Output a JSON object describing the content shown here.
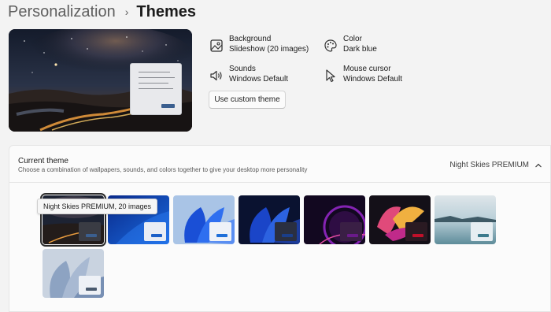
{
  "breadcrumb": {
    "parent": "Personalization",
    "separator": "›",
    "current": "Themes"
  },
  "properties": {
    "background": {
      "label": "Background",
      "value": "Slideshow (20 images)",
      "icon": "image-icon"
    },
    "color": {
      "label": "Color",
      "value": "Dark blue",
      "icon": "palette-icon"
    },
    "sounds": {
      "label": "Sounds",
      "value": "Windows Default",
      "icon": "speaker-icon"
    },
    "mouse_cursor": {
      "label": "Mouse cursor",
      "value": "Windows Default",
      "icon": "cursor-icon"
    }
  },
  "custom_theme_button": "Use custom theme",
  "current_theme": {
    "title": "Current theme",
    "subtitle": "Choose a combination of wallpapers, sounds, and colors together to give your desktop more personality",
    "value": "Night Skies PREMIUM",
    "expanded_icon": "chevron-up-icon"
  },
  "tooltip": "Night Skies PREMIUM, 20 images",
  "themes": [
    {
      "name": "theme-night-skies",
      "style": "night skies",
      "accent": "#3b5f8f",
      "selected": true
    },
    {
      "name": "theme-windows-blue",
      "style": "windows blue",
      "accent": "#1a5fc8",
      "selected": false
    },
    {
      "name": "theme-windows-light-bloom",
      "style": "light bloom",
      "accent": "#1e6fd9",
      "selected": false
    },
    {
      "name": "theme-windows-dark-bloom",
      "style": "dark bloom",
      "accent": "#1a3e8a",
      "selected": false
    },
    {
      "name": "theme-glow",
      "style": "glow",
      "accent": "#6a1a8a",
      "selected": false
    },
    {
      "name": "theme-captured-motion",
      "style": "captured motion",
      "accent": "#c0102a",
      "selected": false
    },
    {
      "name": "theme-sunrise",
      "style": "sunrise",
      "accent": "#3a7a8c",
      "selected": false
    },
    {
      "name": "theme-flow",
      "style": "flow",
      "accent": "#4a5a6e",
      "selected": false
    }
  ]
}
